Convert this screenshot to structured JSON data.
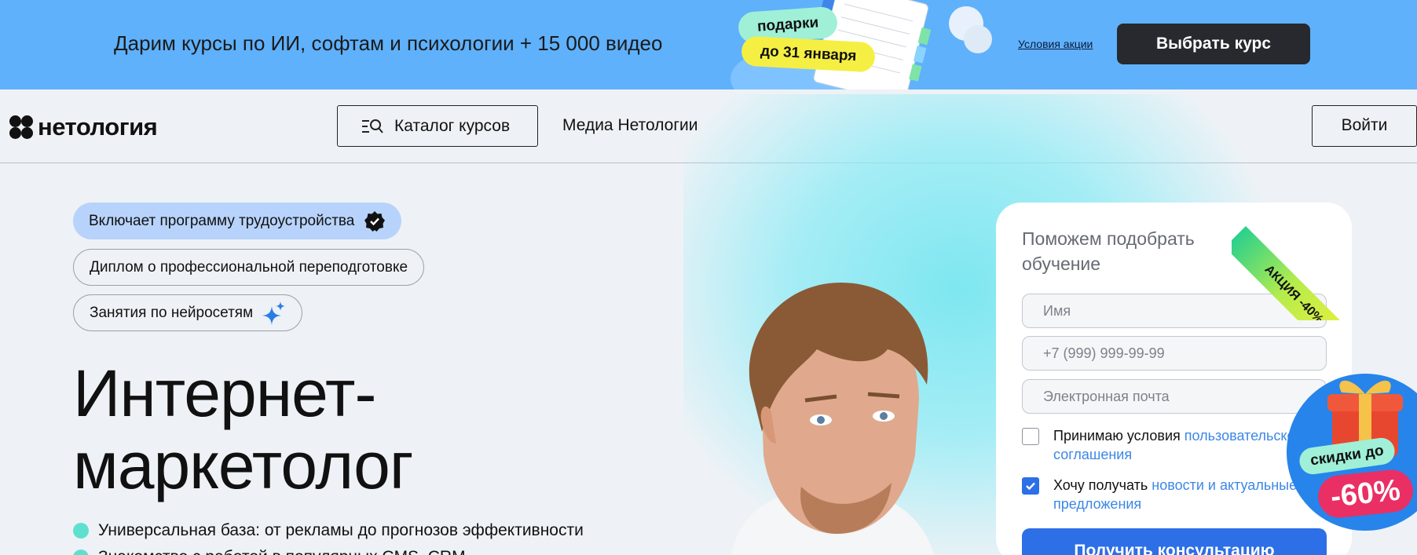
{
  "banner": {
    "text": "Дарим курсы по ИИ, софтам и психологии + 15 000 видео",
    "gifts_label": "подарки",
    "date_label": "до 31 января",
    "terms_link": "Условия акции",
    "cta_label": "Выбрать курс"
  },
  "header": {
    "logo_text": "нетология",
    "catalog_label": "Каталог курсов",
    "media_label": "Медиа Нетологии",
    "login_label": "Войти"
  },
  "hero": {
    "tags": [
      "Включает программу трудоустройства",
      "Диплом о профессиональной переподготовке",
      "Занятия по нейросетям"
    ],
    "title_line1": "Интернет-",
    "title_line2": "маркетолог",
    "bullets": [
      "Универсальная база: от рекламы до прогнозов эффективности",
      "Знакомство с работой в популярных CMS, CRM"
    ]
  },
  "form": {
    "title": "Поможем подобрать обучение",
    "name_placeholder": "Имя",
    "phone_placeholder": "+7 (999) 999-99-99",
    "email_placeholder": "Электронная почта",
    "agreement_text": "Принимаю условия",
    "agreement_link_line1": "пользовательского",
    "agreement_link_line2": "соглашения",
    "agreement_checked": false,
    "news_text": "Хочу получать",
    "news_link_line1": "новости и актуальные",
    "news_link_line2": "предложения",
    "news_checked": true,
    "submit_label": "Получить консультацию",
    "ribbon_text": "АКЦИЯ -40%"
  },
  "badge": {
    "label": "скидки до",
    "value": "-60%"
  },
  "colors": {
    "banner_bg": "#5fb1fb",
    "primary_blue": "#2c6fe6",
    "accent_mint": "#5fe0cf",
    "discount_pink": "#ea2f64"
  },
  "icons": [
    "catalog-search-icon",
    "verified-check-icon",
    "sparkle-icon",
    "gift-icon",
    "checkmark-icon"
  ]
}
